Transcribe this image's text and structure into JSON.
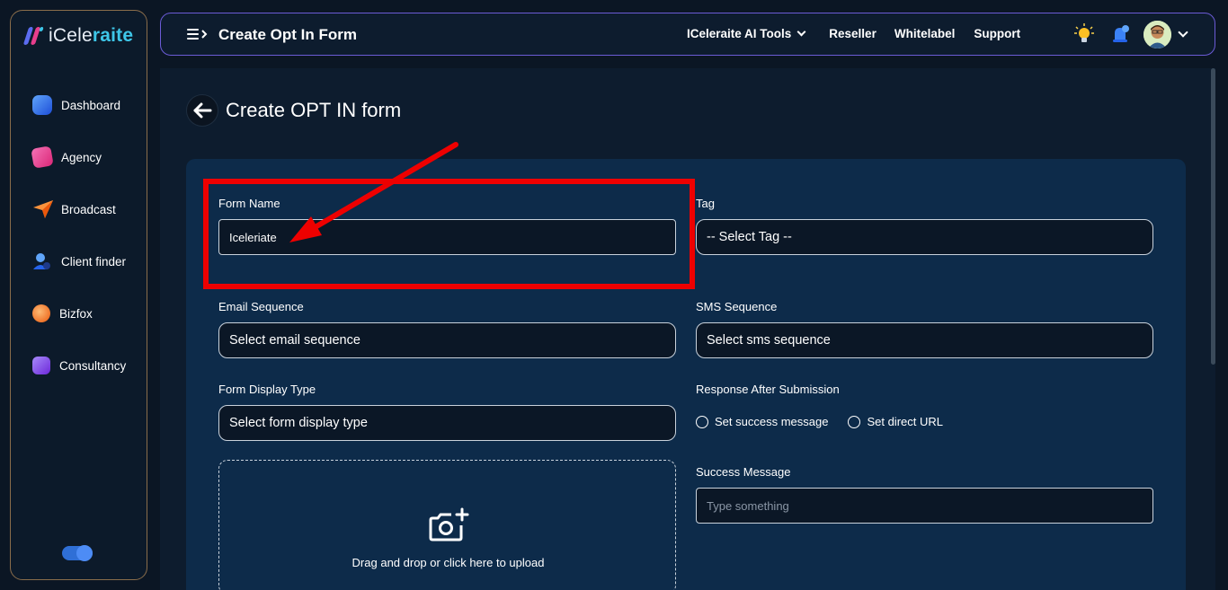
{
  "brand": {
    "name_prefix": "iCele",
    "name_bold": "raite"
  },
  "sidebar": {
    "items": [
      {
        "label": "Dashboard",
        "color": "#3b82f6"
      },
      {
        "label": "Agency",
        "color": "#ec4899"
      },
      {
        "label": "Broadcast",
        "color": "#f97316"
      },
      {
        "label": "Client finder",
        "color": "#3b82f6"
      },
      {
        "label": "Bizfox",
        "color": "#f59e0b"
      },
      {
        "label": "Consultancy",
        "color": "#8b5cf6"
      }
    ]
  },
  "topbar": {
    "title": "Create Opt In Form",
    "links": [
      "ICeleraite AI Tools",
      "Reseller",
      "Whitelabel",
      "Support"
    ]
  },
  "page": {
    "title": "Create OPT IN form"
  },
  "form": {
    "form_name": {
      "label": "Form Name",
      "value": "Iceleriate"
    },
    "tag": {
      "label": "Tag",
      "value": "-- Select Tag --"
    },
    "email_sequence": {
      "label": "Email Sequence",
      "value": "Select email sequence"
    },
    "sms_sequence": {
      "label": "SMS Sequence",
      "value": "Select sms sequence"
    },
    "display_type": {
      "label": "Form Display Type",
      "value": "Select form display type"
    },
    "response": {
      "label": "Response After Submission",
      "options": [
        "Set success message",
        "Set direct URL"
      ]
    },
    "success_message": {
      "label": "Success Message",
      "placeholder": "Type something"
    },
    "upload": {
      "text": "Drag and drop or click here to upload"
    }
  },
  "colors": {
    "accent": "#3ec6e8",
    "highlight": "#ee0000",
    "card": "#0d2b4a"
  }
}
